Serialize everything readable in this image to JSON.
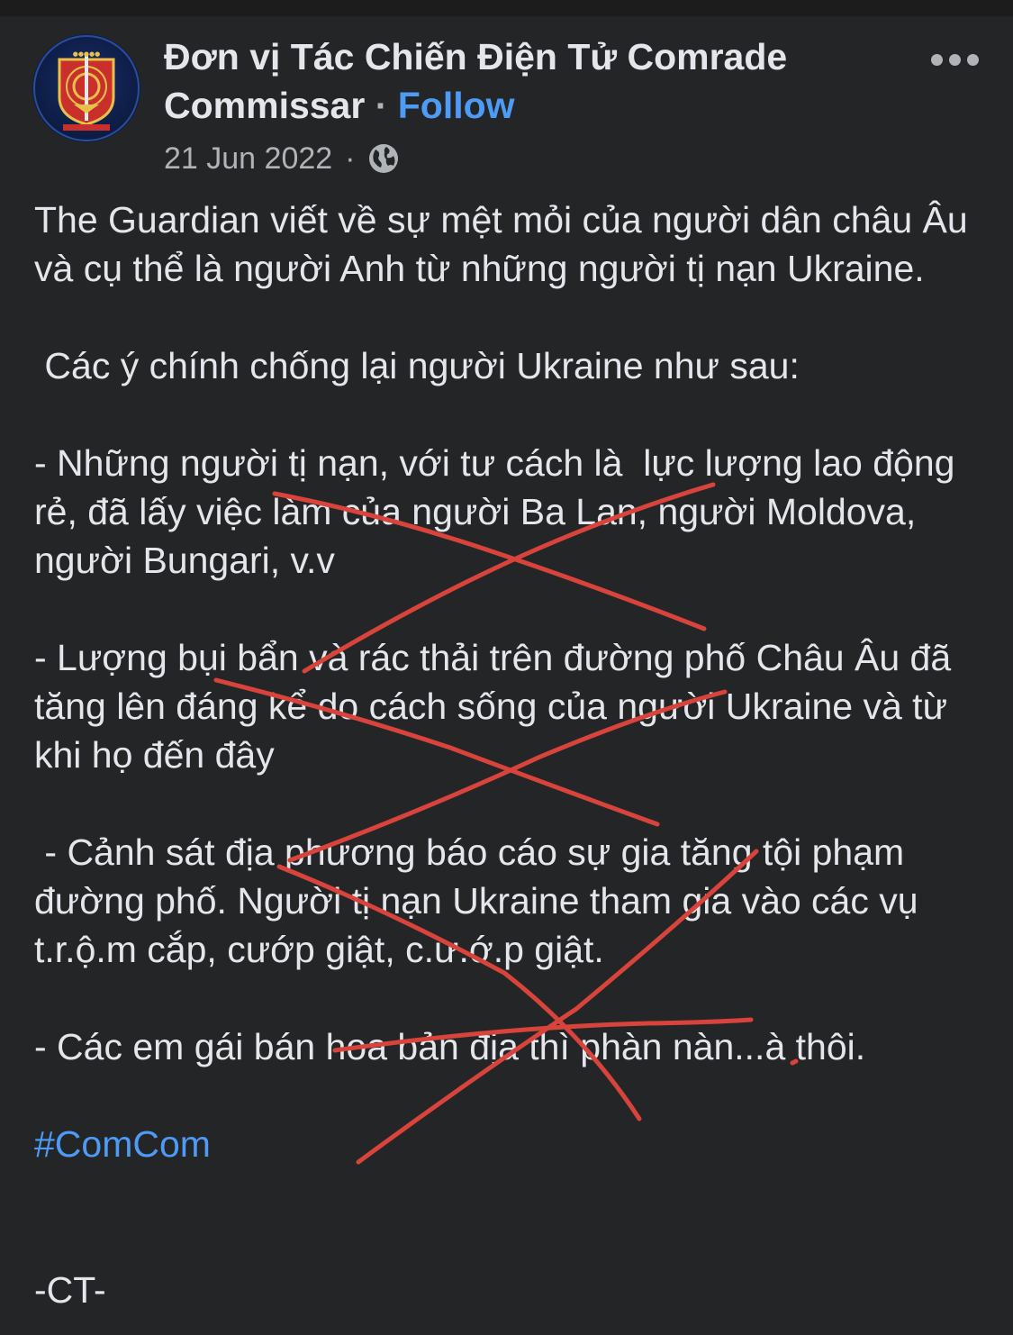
{
  "post": {
    "author_line1": "Đơn vị Tác Chiến Điện Tử Comrade",
    "author_line2": "Commissar",
    "separator": " · ",
    "follow_label": "Follow",
    "date": "21 Jun 2022",
    "meta_separator": "·",
    "privacy_icon": "globe-icon",
    "more_icon": "more-options-icon",
    "avatar_icon": "page-logo",
    "paragraphs": [
      "The Guardian viết về sự mệt mỏi của người dân châu Âu và cụ thể là người Anh từ những người tị nạn Ukraine.",
      " Các ý chính chống lại người Ukraine như sau:",
      "- Những người tị nạn, với tư cách là  lực lượng lao động rẻ, đã lấy việc làm của người Ba Lan, người Moldova, người Bungari, v.v",
      "- Lượng bụi bẩn và rác thải trên đường phố Châu Âu đã tăng lên đáng kể do cách sống của người Ukraine và từ khi họ đến đây",
      " - Cảnh sát địa phương báo cáo sự gia tăng tội phạm đường phố. Người tị nạn Ukraine tham gia vào các vụ t.r.ộ.m cắp, cướp giật, c.ư.ớ.p giật.",
      "- Các em gái bán hoa bản địa thì phàn nàn...à thôi."
    ],
    "hashtag": "#ComCom",
    "signature": "-CT-"
  },
  "colors": {
    "background": "#242526",
    "text": "#e4e6eb",
    "secondary_text": "#b0b3b8",
    "link": "#4e9bf5",
    "scribble": "#d8433c"
  }
}
